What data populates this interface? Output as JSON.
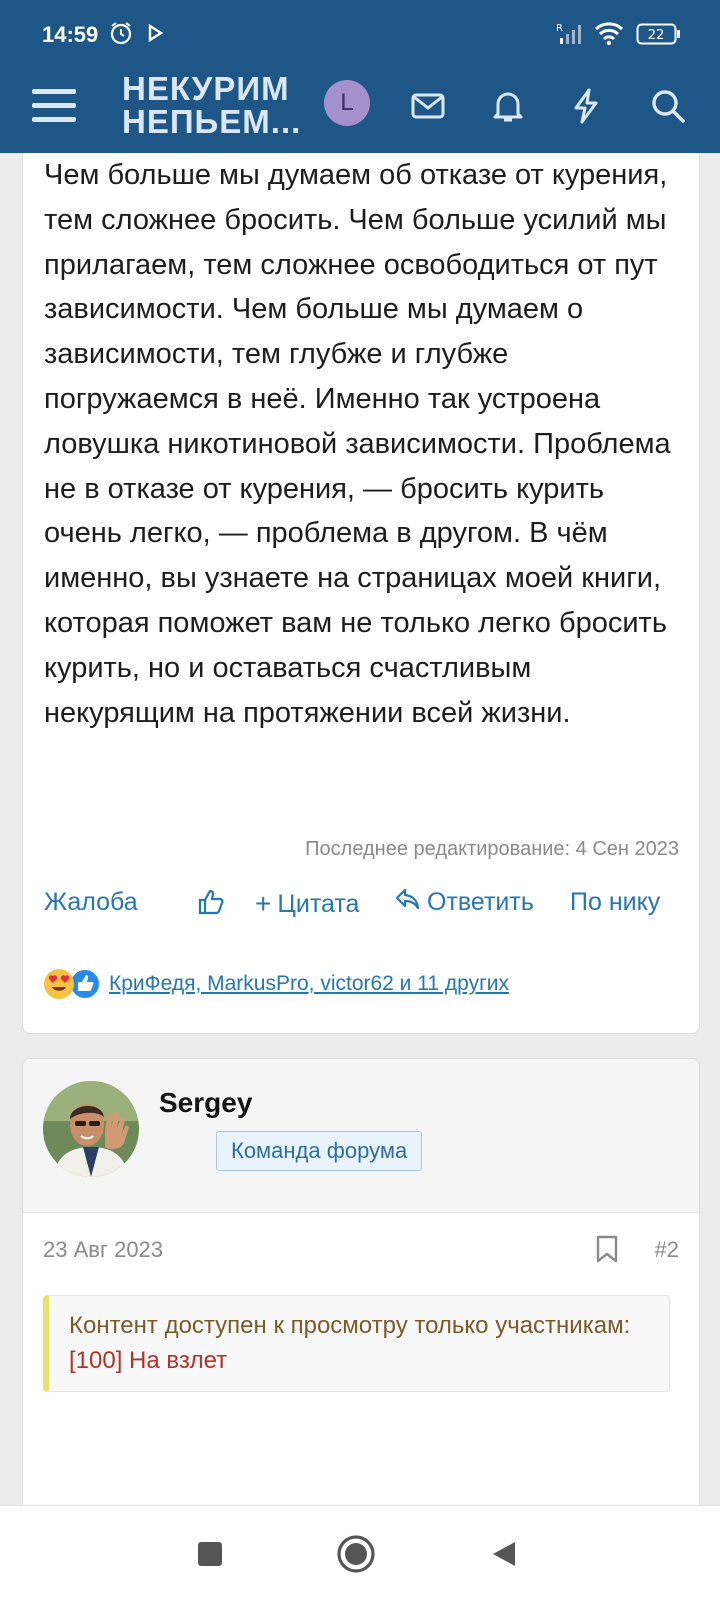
{
  "status_bar": {
    "time": "14:59",
    "battery": "22",
    "icons": [
      "alarm-icon",
      "play-icon",
      "signal-icon",
      "wifi-icon",
      "battery-icon"
    ]
  },
  "header": {
    "logo_line1": "НЕКУРИМ",
    "logo_line2": "НЕПЬЕМ...",
    "avatar_letter": "L",
    "icons": [
      "menu-icon",
      "mail-icon",
      "bell-icon",
      "lightning-icon",
      "search-icon"
    ]
  },
  "post1": {
    "text": "Чем больше мы думаем об отказе от курения, тем сложнее бросить. Чем больше усилий мы прилагаем, тем сложнее освободиться от пут зависимости. Чем больше мы думаем о зависимости, тем глубже и глубже погружаемся в неё. Именно так устроена ловушка никотиновой зависимости. Проблема не в отказе от курения, — бросить курить очень легко, — проблема в другом. В чём именно, вы узнаете на страницах моей книги, которая поможет вам не только легко бросить курить, но и оставаться счастливым некурящим на протяжении всей жизни.",
    "edited": "Последнее редактирование: 4 Сен 2023",
    "actions": {
      "report": "Жалоба",
      "quote": "Цитата",
      "reply": "Ответить",
      "by_nick": "По нику"
    },
    "reactions_text": "КриФедя, MarkusPro, victor62 и 11 других"
  },
  "post2": {
    "username": "Sergey",
    "role": "Команда форума",
    "date": "23 Авг 2023",
    "number": "#2",
    "notice_prefix": "Контент доступен к просмотру только участникам: ",
    "notice_link": "[100] На взлет"
  },
  "colors": {
    "header_bg": "#1e5787",
    "link": "#2577b1",
    "notice_border": "#e6e36a"
  }
}
